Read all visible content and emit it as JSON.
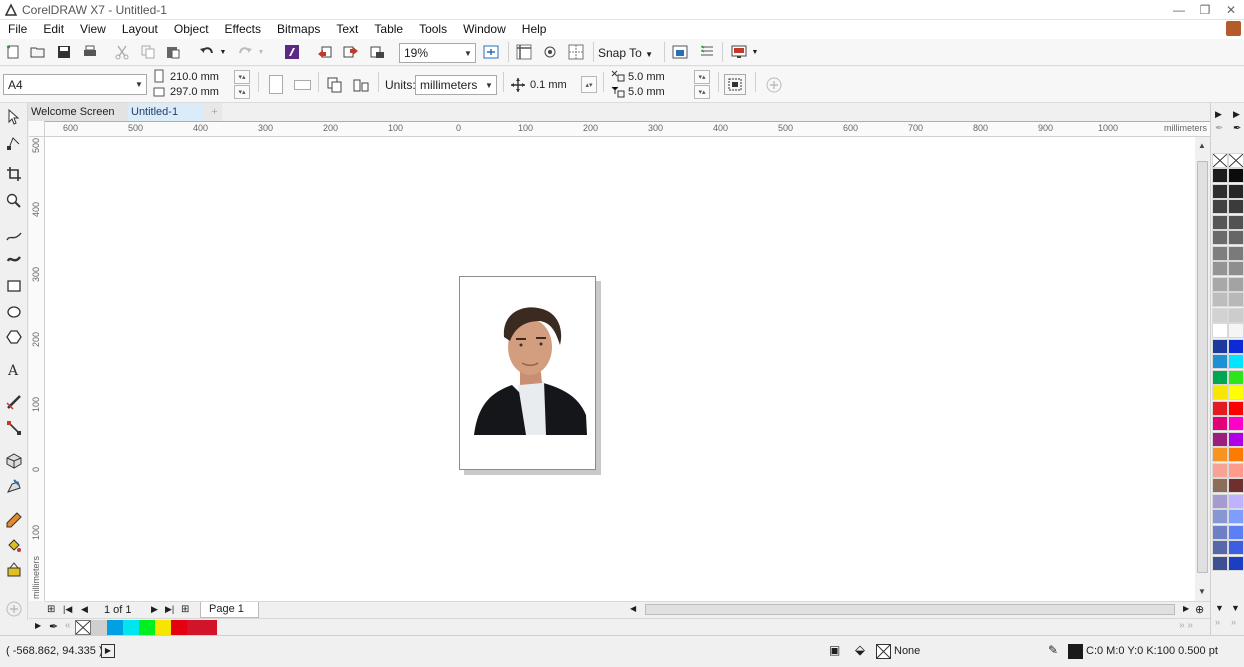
{
  "window": {
    "title": "CorelDRAW X7 - Untitled-1"
  },
  "menu": [
    "File",
    "Edit",
    "View",
    "Layout",
    "Object",
    "Effects",
    "Bitmaps",
    "Text",
    "Table",
    "Tools",
    "Window",
    "Help"
  ],
  "toolbar": {
    "zoom": "19%",
    "snap_to": "Snap To"
  },
  "propbar": {
    "page_size": "A4",
    "width": "210.0 mm",
    "height": "297.0 mm",
    "units_label": "Units:",
    "units_value": "millimeters",
    "nudge": "0.1 mm",
    "dup_x": "5.0 mm",
    "dup_y": "5.0 mm"
  },
  "tabs": {
    "welcome": "Welcome Screen",
    "document": "Untitled-1",
    "add": "+"
  },
  "ruler": {
    "h_labels": [
      "600",
      "500",
      "400",
      "300",
      "200",
      "100",
      "0",
      "100",
      "200",
      "300",
      "400",
      "500",
      "600",
      "700",
      "800",
      "900",
      "1000"
    ],
    "h_unit": "millimeters",
    "v_labels": [
      "500",
      "400",
      "300",
      "200",
      "100",
      "0",
      "100"
    ],
    "v_unit": "millimeters"
  },
  "pagenav": {
    "counter": "1 of 1",
    "page_tab": "Page 1"
  },
  "status": {
    "coords": "( -568.862, 94.335 )",
    "fill": "None",
    "outline": "C:0 M:0 Y:0 K:100  0.500 pt"
  },
  "colors": {
    "accent": "#1e72b8",
    "doc_palette": [
      "#00a0e3",
      "#00e5ee",
      "#00ee22",
      "#f5e500",
      "#e50010",
      "#d2142a"
    ],
    "palette_left": [
      "#1c1c1c",
      "#2e2e2e",
      "#424242",
      "#565656",
      "#6b6b6b",
      "#7f7f7f",
      "#949494",
      "#a8a8a8",
      "#bdbdbd",
      "#d2d2d2",
      "#ffffff",
      "#1b3a9b",
      "#1e90d4",
      "#00a650",
      "#f7e600",
      "#e31b23",
      "#e2007a",
      "#9d1f7d",
      "#f7941d",
      "#f6a394",
      "#8b6e5a",
      "#a69bd0",
      "#8697d3",
      "#6f7fc4",
      "#5668aa",
      "#3e4f92"
    ],
    "palette_right": [
      "#0c0c0c",
      "#262626",
      "#3b3b3b",
      "#525252",
      "#666666",
      "#7a7a7a",
      "#8e8e8e",
      "#a3a3a3",
      "#b8b8b8",
      "#cccccc",
      "#f5f5f5",
      "#0a2bd6",
      "#00e5ff",
      "#2ee51a",
      "#ffff00",
      "#ff0000",
      "#ff00c8",
      "#b100e8",
      "#ff7a00",
      "#ff9b8b",
      "#6f2f2f",
      "#c1b2ff",
      "#7d9dff",
      "#5d7ff5",
      "#3d5ee0",
      "#1c3fc2"
    ]
  }
}
